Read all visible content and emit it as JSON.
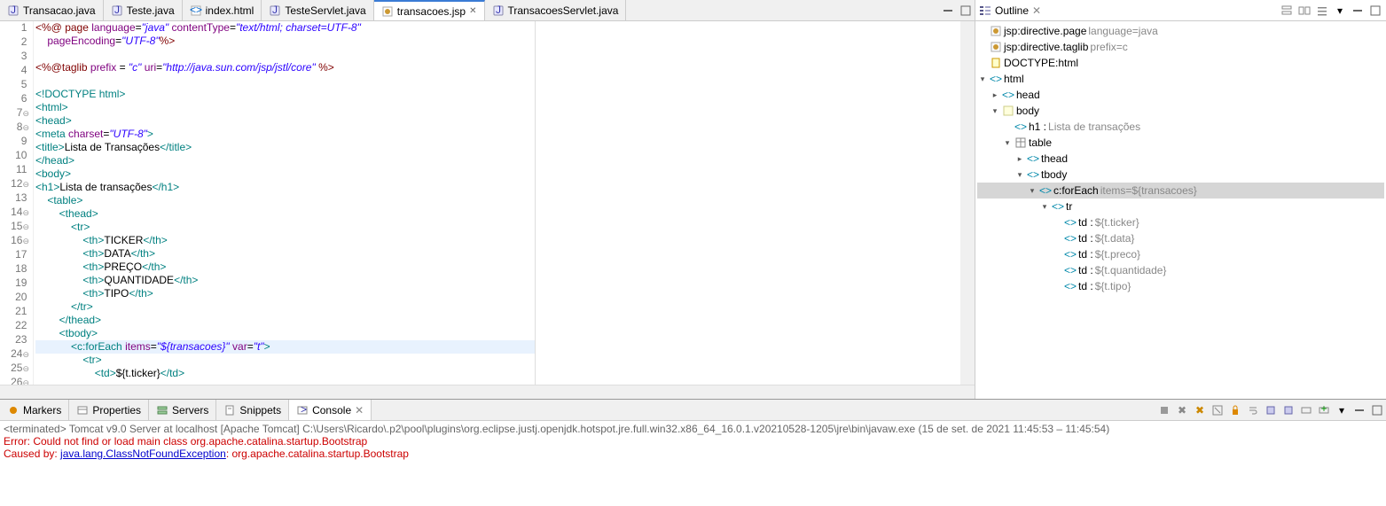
{
  "tabs": [
    {
      "label": "Transacao.java",
      "icon": "java"
    },
    {
      "label": "Teste.java",
      "icon": "java"
    },
    {
      "label": "index.html",
      "icon": "html"
    },
    {
      "label": "TesteServlet.java",
      "icon": "java"
    },
    {
      "label": "transacoes.jsp",
      "icon": "jsp",
      "active": true,
      "close": true
    },
    {
      "label": "TransacoesServlet.java",
      "icon": "java"
    }
  ],
  "code_lines": [
    {
      "n": "1",
      "fold": "",
      "html": "<span class='maroon'>&lt;%@</span> <span class='maroon'>page</span> <span class='attr'>language</span>=<span class='str'>\"java\"</span> <span class='attr'>contentType</span>=<span class='str'>\"text/html; charset=UTF-8\"</span>"
    },
    {
      "n": "2",
      "fold": "",
      "html": "    <span class='attr'>pageEncoding</span>=<span class='str'>\"UTF-8\"</span><span class='maroon'>%&gt;</span>"
    },
    {
      "n": "3",
      "fold": "",
      "html": ""
    },
    {
      "n": "4",
      "fold": "",
      "html": "<span class='maroon'>&lt;%@taglib</span> <span class='attr'>prefix</span> = <span class='str'>\"c\"</span> <span class='attr'>uri</span>=<span class='str'>\"http://java.sun.com/jsp/jstl/core\"</span> <span class='maroon'>%&gt;</span>"
    },
    {
      "n": "5",
      "fold": "",
      "html": ""
    },
    {
      "n": "6",
      "fold": "",
      "html": "<span class='tag'>&lt;!DOCTYPE</span> <span class='tag'>html&gt;</span>"
    },
    {
      "n": "7",
      "fold": "⊖",
      "html": "<span class='tag'>&lt;html&gt;</span>"
    },
    {
      "n": "8",
      "fold": "⊖",
      "html": "<span class='tag'>&lt;head&gt;</span>"
    },
    {
      "n": "9",
      "fold": "",
      "html": "<span class='tag'>&lt;meta</span> <span class='attr'>charset</span>=<span class='str'>\"UTF-8\"</span><span class='tag'>&gt;</span>"
    },
    {
      "n": "10",
      "fold": "",
      "html": "<span class='tag'>&lt;title&gt;</span><span class='txt'>Lista de Transações</span><span class='tag'>&lt;/title&gt;</span>"
    },
    {
      "n": "11",
      "fold": "",
      "html": "<span class='tag'>&lt;/head&gt;</span>"
    },
    {
      "n": "12",
      "fold": "⊖",
      "html": "<span class='tag'>&lt;body&gt;</span>"
    },
    {
      "n": "13",
      "fold": "",
      "html": "<span class='tag'>&lt;h1&gt;</span><span class='txt'>Lista de transações</span><span class='tag'>&lt;/h1&gt;</span>"
    },
    {
      "n": "14",
      "fold": "⊖",
      "html": "    <span class='tag'>&lt;table&gt;</span>"
    },
    {
      "n": "15",
      "fold": "⊖",
      "html": "        <span class='tag'>&lt;thead&gt;</span>"
    },
    {
      "n": "16",
      "fold": "⊖",
      "html": "            <span class='tag'>&lt;tr&gt;</span>"
    },
    {
      "n": "17",
      "fold": "",
      "html": "                <span class='tag'>&lt;th&gt;</span><span class='txt'>TICKER</span><span class='tag'>&lt;/th&gt;</span>"
    },
    {
      "n": "18",
      "fold": "",
      "html": "                <span class='tag'>&lt;th&gt;</span><span class='txt'>DATA</span><span class='tag'>&lt;/th&gt;</span>"
    },
    {
      "n": "19",
      "fold": "",
      "html": "                <span class='tag'>&lt;th&gt;</span><span class='txt'>PREÇO</span><span class='tag'>&lt;/th&gt;</span>"
    },
    {
      "n": "20",
      "fold": "",
      "html": "                <span class='tag'>&lt;th&gt;</span><span class='txt'>QUANTIDADE</span><span class='tag'>&lt;/th&gt;</span>"
    },
    {
      "n": "21",
      "fold": "",
      "html": "                <span class='tag'>&lt;th&gt;</span><span class='txt'>TIPO</span><span class='tag'>&lt;/th&gt;</span>"
    },
    {
      "n": "22",
      "fold": "",
      "html": "            <span class='tag'>&lt;/tr&gt;</span>"
    },
    {
      "n": "23",
      "fold": "",
      "html": "        <span class='tag'>&lt;/thead&gt;</span>"
    },
    {
      "n": "24",
      "fold": "⊖",
      "html": "        <span class='tag'>&lt;tbody&gt;</span>"
    },
    {
      "n": "25",
      "fold": "⊖",
      "hl": true,
      "html": "            <span class='tag'>&lt;c:forEach</span> <span class='attr'>items</span>=<span class='str'>\"${transacoes}\"</span> <span class='attr'>var</span>=<span class='str'>\"t\"</span><span class='tag'>&gt;</span>"
    },
    {
      "n": "26",
      "fold": "⊖",
      "html": "                <span class='tag'>&lt;tr&gt;</span>"
    },
    {
      "n": "27",
      "fold": "",
      "html": "                    <span class='tag'>&lt;td&gt;</span><span class='txt'>${t.ticker}</span><span class='tag'>&lt;/td&gt;</span>"
    }
  ],
  "outline": {
    "title": "Outline",
    "items": [
      {
        "ind": 0,
        "arrow": "",
        "icon": "jsp",
        "label": "jsp:directive.page ",
        "meta": "language=java"
      },
      {
        "ind": 0,
        "arrow": "",
        "icon": "jsp",
        "label": "jsp:directive.taglib ",
        "meta": "prefix=c"
      },
      {
        "ind": 0,
        "arrow": "",
        "icon": "doctype",
        "label": "DOCTYPE:html",
        "meta": ""
      },
      {
        "ind": 0,
        "arrow": "▾",
        "icon": "tag",
        "label": "html",
        "meta": ""
      },
      {
        "ind": 1,
        "arrow": "▸",
        "icon": "tag",
        "label": "head",
        "meta": ""
      },
      {
        "ind": 1,
        "arrow": "▾",
        "icon": "body",
        "label": "body",
        "meta": ""
      },
      {
        "ind": 2,
        "arrow": "",
        "icon": "tag",
        "label": "h1 : ",
        "meta": "Lista de transações"
      },
      {
        "ind": 2,
        "arrow": "▾",
        "icon": "table",
        "label": "table",
        "meta": ""
      },
      {
        "ind": 3,
        "arrow": "▸",
        "icon": "tag",
        "label": "thead",
        "meta": ""
      },
      {
        "ind": 3,
        "arrow": "▾",
        "icon": "tag",
        "label": "tbody",
        "meta": ""
      },
      {
        "ind": 4,
        "arrow": "▾",
        "icon": "tag",
        "label": "c:forEach ",
        "meta": "items=${transacoes}",
        "sel": true
      },
      {
        "ind": 5,
        "arrow": "▾",
        "icon": "tag",
        "label": "tr",
        "meta": ""
      },
      {
        "ind": 6,
        "arrow": "",
        "icon": "tag",
        "label": "td : ",
        "meta": "${t.ticker}"
      },
      {
        "ind": 6,
        "arrow": "",
        "icon": "tag",
        "label": "td : ",
        "meta": "${t.data}"
      },
      {
        "ind": 6,
        "arrow": "",
        "icon": "tag",
        "label": "td : ",
        "meta": "${t.preco}"
      },
      {
        "ind": 6,
        "arrow": "",
        "icon": "tag",
        "label": "td : ",
        "meta": "${t.quantidade}"
      },
      {
        "ind": 6,
        "arrow": "",
        "icon": "tag",
        "label": "td : ",
        "meta": "${t.tipo}"
      }
    ]
  },
  "bottom_tabs": [
    {
      "label": "Markers",
      "icon": "markers"
    },
    {
      "label": "Properties",
      "icon": "props"
    },
    {
      "label": "Servers",
      "icon": "servers"
    },
    {
      "label": "Snippets",
      "icon": "snip"
    },
    {
      "label": "Console",
      "icon": "console",
      "active": true,
      "close": true
    }
  ],
  "console": {
    "header": "<terminated> Tomcat v9.0 Server at localhost [Apache Tomcat] C:\\Users\\Ricardo\\.p2\\pool\\plugins\\org.eclipse.justj.openjdk.hotspot.jre.full.win32.x86_64_16.0.1.v20210528-1205\\jre\\bin\\javaw.exe  (15 de set. de 2021 11:45:53 – 11:45:54)",
    "line1_a": "Error: Could not find or load main class org.apache.catalina.startup.Bootstrap",
    "line2_a": "Caused by: ",
    "line2_link": "java.lang.ClassNotFoundException",
    "line2_b": ": org.apache.catalina.startup.Bootstrap"
  }
}
